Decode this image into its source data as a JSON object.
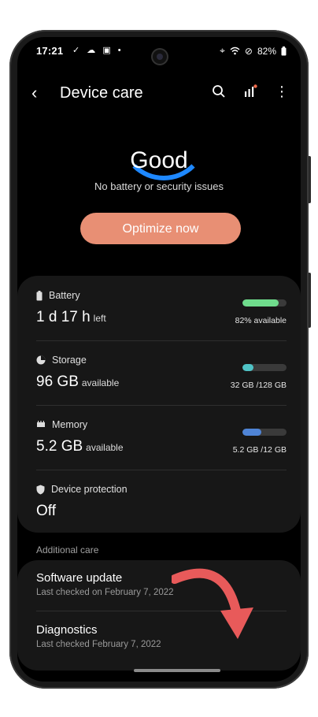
{
  "status_bar": {
    "time": "17:21",
    "left_icons": "✓ ☁ ▣ •",
    "battery": "82%"
  },
  "appbar": {
    "title": "Device care"
  },
  "summary": {
    "status": "Good",
    "subtitle": "No battery or security issues",
    "optimize_label": "Optimize now"
  },
  "battery": {
    "label": "Battery",
    "value": "1 d 17 h",
    "unit": "left",
    "caption": "82% available",
    "level": 0.82,
    "color": "#6fdc8c"
  },
  "storage": {
    "label": "Storage",
    "value": "96 GB",
    "unit": "available",
    "caption": "32 GB /128 GB",
    "level": 0.25,
    "color": "#4fc3c6"
  },
  "memory": {
    "label": "Memory",
    "value": "5.2 GB",
    "unit": "available",
    "caption": "5.2 GB /12 GB",
    "level": 0.43,
    "color": "#4f84d6"
  },
  "protection": {
    "label": "Device protection",
    "value": "Off"
  },
  "additional": {
    "section_label": "Additional care",
    "software_update": {
      "title": "Software update",
      "subtitle": "Last checked on February 7, 2022"
    },
    "diagnostics": {
      "title": "Diagnostics",
      "subtitle": "Last checked February 7, 2022"
    }
  },
  "colors": {
    "accent": "#e88f74",
    "arc": "#1e88ff",
    "arrow": "#e85a5a"
  }
}
